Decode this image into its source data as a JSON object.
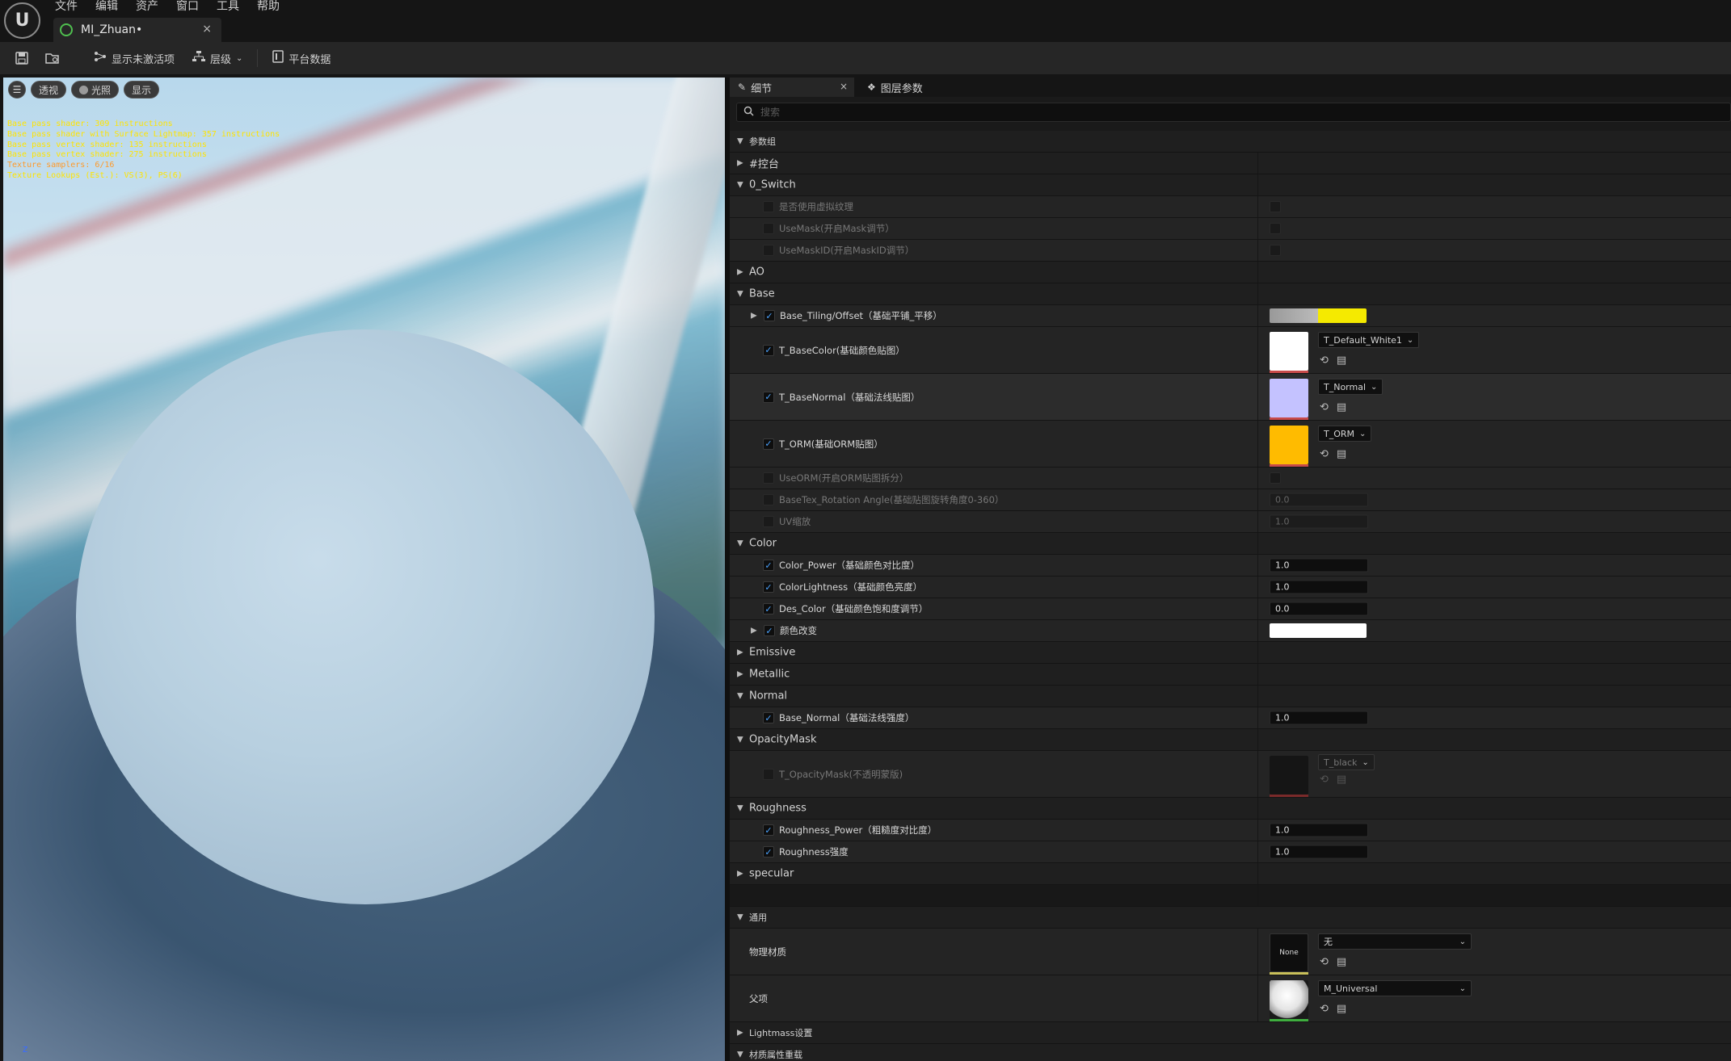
{
  "menu": [
    "文件",
    "编辑",
    "资产",
    "窗口",
    "工具",
    "帮助"
  ],
  "logo": "U",
  "doc_tab": {
    "title": "MI_Zhuan•",
    "close": "×"
  },
  "toolbar": {
    "show_inactive": "显示未激活项",
    "hierarchy": "层级",
    "platform_data": "平台数据"
  },
  "viewport": {
    "buttons": {
      "menu": "☰",
      "perspective": "透视",
      "lit": "光照",
      "show": "显示"
    },
    "stats": [
      "Base pass shader: 309 instructions",
      "Base pass shader with Surface Lightmap: 357 instructions",
      "Base pass vertex shader: 135 instructions",
      "Base pass vertex shader: 275 instructions",
      "Texture samplers: 6/16",
      "Texture Lookups (Est.): VS(3), PS(6)"
    ],
    "axis": "z"
  },
  "panel": {
    "tab_details": "细节",
    "tab_layers": "图层参数",
    "close": "×",
    "search_placeholder": "搜索"
  },
  "rows": {
    "param_group": "参数组",
    "console": "#控台",
    "switch": "0_Switch",
    "use_virtual_texture": "是否使用虚拟纹理",
    "use_mask": "UseMask(开启Mask调节）",
    "use_mask_id": "UseMaskID(开启MaskID调节）",
    "ao": "AO",
    "base": "Base",
    "base_tiling": "Base_Tiling/Offset（基础平铺_平移）",
    "t_basecolor": "T_BaseColor(基础颜色贴图）",
    "t_basecolor_asset": "T_Default_White1",
    "t_basenormal": "T_BaseNormal（基础法线贴图）",
    "t_basenormal_asset": "T_Normal",
    "t_orm": "T_ORM(基础ORM贴图）",
    "t_orm_asset": "T_ORM",
    "use_orm": "UseORM(开启ORM贴图拆分）",
    "basetex_rotation": "BaseTex_Rotation Angle(基础贴图旋转角度0-360）",
    "basetex_rotation_val": "0.0",
    "uv_scale": "UV缩放",
    "uv_scale_val": "1.0",
    "color": "Color",
    "color_power": "Color_Power（基础颜色对比度）",
    "color_power_val": "1.0",
    "color_lightness": "ColorLightness（基础颜色亮度）",
    "color_lightness_val": "1.0",
    "des_color": "Des_Color（基础颜色饱和度调节）",
    "des_color_val": "0.0",
    "color_change": "颜色改变",
    "emissive": "Emissive",
    "metallic": "Metallic",
    "normal": "Normal",
    "base_normal": "Base_Normal（基础法线强度）",
    "base_normal_val": "1.0",
    "opacity_mask": "OpacityMask",
    "t_opacitymask": "T_OpacityMask(不透明蒙版)",
    "t_opacitymask_asset": "T_black",
    "roughness": "Roughness",
    "roughness_power": "Roughness_Power（粗糙度对比度）",
    "roughness_power_val": "1.0",
    "roughness_strength": "Roughness强度",
    "roughness_strength_val": "1.0",
    "specular": "specular",
    "general": "通用",
    "phys_material": "物理材质",
    "phys_material_thumb": "None",
    "phys_material_asset": "无",
    "parent": "父项",
    "parent_asset": "M_Universal",
    "lightmass": "Lightmass设置",
    "material_override": "材质属性重载"
  },
  "colors": {
    "accent_check": "#4aa3ff",
    "base_tiling_swatch": "#f5ea00",
    "normal_thumb": "#c4c2ff",
    "orm_thumb": "#ffbb00",
    "color_change_swatch": "#ffffff"
  },
  "icons": {
    "save": "save-icon",
    "browse": "browse-icon",
    "node": "node-icon",
    "hierarchy": "hierarchy-icon",
    "platform": "platform-icon",
    "pencil": "pencil-icon",
    "layers": "layers-icon",
    "search": "search-icon"
  }
}
